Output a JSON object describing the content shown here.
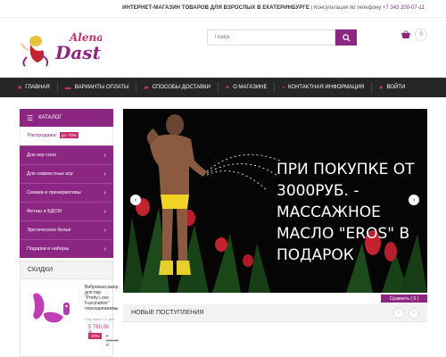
{
  "topbar": {
    "store_name": "ИНТЕРНЕТ-МАГАЗИН ТОВАРОВ ДЛЯ ВЗРОСЛЫХ В ЕКАТЕРИНБУРГЕ",
    "consult_label": "| Консультация по телефону",
    "phone": "+7 343 200-07-11"
  },
  "logo": {
    "line1": "Alena",
    "line2": "Dast"
  },
  "search": {
    "placeholder": "Поиск"
  },
  "cart": {
    "count": "0"
  },
  "nav": [
    {
      "label": "ГЛАВНАЯ",
      "icon": "home-icon"
    },
    {
      "label": "ВАРИАНТЫ ОПЛАТЫ",
      "icon": "card-icon"
    },
    {
      "label": "СПОСОБЫ ДОСТАВКИ",
      "icon": "truck-icon"
    },
    {
      "label": "О МАГАЗИНЕ",
      "icon": "heart-icon"
    },
    {
      "label": "КОНТАКТНАЯ ИНФОРМАЦИЯ",
      "icon": "contact-card-icon"
    },
    {
      "label": "ВОЙТИ",
      "icon": "user-icon"
    }
  ],
  "catalog": {
    "title": "КАТАЛОГ",
    "items": [
      {
        "label": "Распродажа!",
        "badge": "до -70%"
      },
      {
        "label": "Для игр соло"
      },
      {
        "label": "Для совместных игр"
      },
      {
        "label": "Смазки и презервативы"
      },
      {
        "label": "Фетиш и БДСМ"
      },
      {
        "label": "Эротическое бельё"
      },
      {
        "label": "Подарки и наборы"
      }
    ]
  },
  "discounts": {
    "title": "СКИДКИ",
    "product": {
      "title": "Вибромассажер для пар \"Pretty Love Fascination\" перезаряжаемы",
      "note": "Под заказ 1-2 дня",
      "price": "5 760,00 ₽",
      "discount": "-20%",
      "old_price": "7 200,00 ₽"
    }
  },
  "banner": {
    "text": "ПРИ ПОКУПКЕ ОТ 3000РУБ. - МАССАЖНОЕ МАСЛО \"EROS\" В ПОДАРОК",
    "colors": {
      "accent": "#8b2682",
      "flower": "#c3222f",
      "leaves": "#1d4a1a",
      "bg": "#050505"
    }
  },
  "compare": {
    "label": "Сравнить ( 0 )"
  },
  "new_arrivals": {
    "title": "НОВЫЕ ПОСТУПЛЕНИЯ"
  },
  "colors": {
    "brand": "#8b2682",
    "pink": "#c62f6b",
    "nav_bg": "#262626"
  }
}
